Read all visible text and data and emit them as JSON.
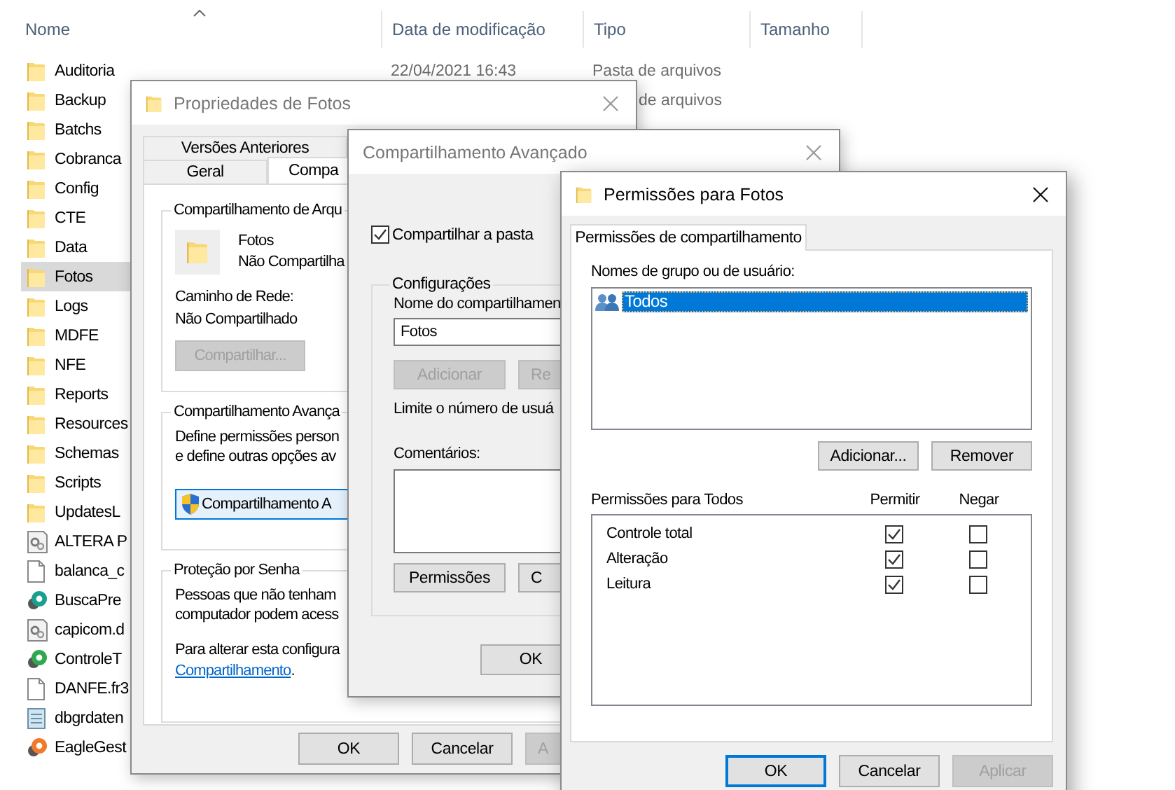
{
  "explorer": {
    "columns": [
      "Nome",
      "Data de modificação",
      "Tipo",
      "Tamanho"
    ],
    "files": [
      {
        "name": "Auditoria",
        "kind": "folder",
        "selected": false,
        "modified": "22/04/2021 16:43",
        "type": "Pasta de arquivos",
        "type_start_hidden": false
      },
      {
        "name": "Backup",
        "kind": "folder",
        "selected": false,
        "type": "de arquivos",
        "type_start_hidden": true
      },
      {
        "name": "Batchs",
        "kind": "folder",
        "selected": false
      },
      {
        "name": "Cobranca",
        "kind": "folder",
        "selected": false
      },
      {
        "name": "Config",
        "kind": "folder",
        "selected": false
      },
      {
        "name": "CTE",
        "kind": "folder",
        "selected": false
      },
      {
        "name": "Data",
        "kind": "folder",
        "selected": false
      },
      {
        "name": "Fotos",
        "kind": "folder",
        "selected": true
      },
      {
        "name": "Logs",
        "kind": "folder",
        "selected": false
      },
      {
        "name": "MDFE",
        "kind": "folder",
        "selected": false
      },
      {
        "name": "NFE",
        "kind": "folder",
        "selected": false
      },
      {
        "name": "Reports",
        "kind": "folder",
        "selected": false
      },
      {
        "name": "Resources",
        "kind": "folder",
        "selected": false
      },
      {
        "name": "Schemas",
        "kind": "folder",
        "selected": false
      },
      {
        "name": "Scripts",
        "kind": "folder",
        "selected": false
      },
      {
        "name": "UpdatesL",
        "kind": "folder",
        "selected": false
      },
      {
        "name": "ALTERA P",
        "kind": "settings-file",
        "selected": false
      },
      {
        "name": "balanca_c",
        "kind": "document",
        "selected": false
      },
      {
        "name": "BuscaPre",
        "kind": "app",
        "color": "#1a9e8f",
        "selected": false
      },
      {
        "name": "capicom.d",
        "kind": "settings-file",
        "selected": false
      },
      {
        "name": "ControleT",
        "kind": "app",
        "color": "#2fa84f",
        "selected": false
      },
      {
        "name": "DANFE.fr3",
        "kind": "document",
        "selected": false
      },
      {
        "name": "dbgrdaten",
        "kind": "notepad",
        "selected": false
      },
      {
        "name": "EagleGest",
        "kind": "app",
        "color": "#f07a28",
        "selected": false
      }
    ]
  },
  "properties_dialog": {
    "title": "Propriedades de Fotos",
    "tabs_back": [
      {
        "label": "Versões Anteriores",
        "selected": false
      }
    ],
    "tabs_front": [
      {
        "label": "Geral",
        "selected": false
      },
      {
        "label": "Compa",
        "selected": true
      }
    ],
    "file_sharing": {
      "title": "Compartilhamento de Arqu",
      "name": "Fotos",
      "status": "Não Compartilha",
      "path_label": "Caminho de Rede:",
      "path": "Não Compartilhado",
      "button": {
        "label": "Compartilhar...",
        "disabled": true
      }
    },
    "advanced_sharing": {
      "title": "Compartilhamento Avança",
      "lines": [
        "Define permissões person",
        "e define outras opções av"
      ],
      "button": "Compartilhamento A"
    },
    "password_protection": {
      "title": "Proteção por Senha",
      "lines": [
        "Pessoas que não tenham",
        "computador podem acess"
      ],
      "change_text": "Para alterar esta configura",
      "link": "Compartilhamento",
      "link_suffix": "."
    },
    "buttons": [
      {
        "label": "OK",
        "disabled": false,
        "cut": false
      },
      {
        "label": "Cancelar",
        "disabled": false,
        "cut": false
      },
      {
        "label": "A",
        "disabled": true,
        "cut": true
      }
    ]
  },
  "advanced_sharing_dialog": {
    "title": "Compartilhamento Avançado",
    "share_checkbox": {
      "label": "Compartilhar a pasta",
      "checked": true
    },
    "settings": {
      "title": "Configurações",
      "name_label": "Nome do compartilhamen",
      "name_value": "Fotos",
      "user_buttons": [
        {
          "label": "Adicionar",
          "disabled": true,
          "cut": false
        },
        {
          "label": "Re",
          "disabled": true,
          "cut": true
        }
      ],
      "limit_text": "Limite o número de usuá",
      "comments_label": "Comentários:",
      "bottom_buttons": [
        {
          "label": "Permissões",
          "disabled": false,
          "cut": false
        },
        {
          "label": "C",
          "disabled": false,
          "cut": true
        }
      ]
    },
    "ok_button": "OK"
  },
  "permissions_dialog": {
    "title": "Permissões para Fotos",
    "tabs": [
      {
        "label": "Permissões de compartilhamento",
        "selected": true
      }
    ],
    "users_label": "Nomes de grupo ou de usuário:",
    "users": [
      {
        "name": "Todos",
        "selected": true
      }
    ],
    "user_buttons": [
      {
        "label": "Adicionar...",
        "disabled": false
      },
      {
        "label": "Remover",
        "disabled": false
      }
    ],
    "permissions_label": "Permissões para Todos",
    "allow_header": "Permitir",
    "deny_header": "Negar",
    "permissions": [
      {
        "name": "Controle total",
        "allow": true,
        "deny": false
      },
      {
        "name": "Alteração",
        "allow": true,
        "deny": false
      },
      {
        "name": "Leitura",
        "allow": true,
        "deny": false
      }
    ],
    "buttons": [
      {
        "label": "OK",
        "default": true,
        "disabled": false
      },
      {
        "label": "Cancelar",
        "default": false,
        "disabled": false
      },
      {
        "label": "Aplicar",
        "default": false,
        "disabled": true
      }
    ]
  }
}
